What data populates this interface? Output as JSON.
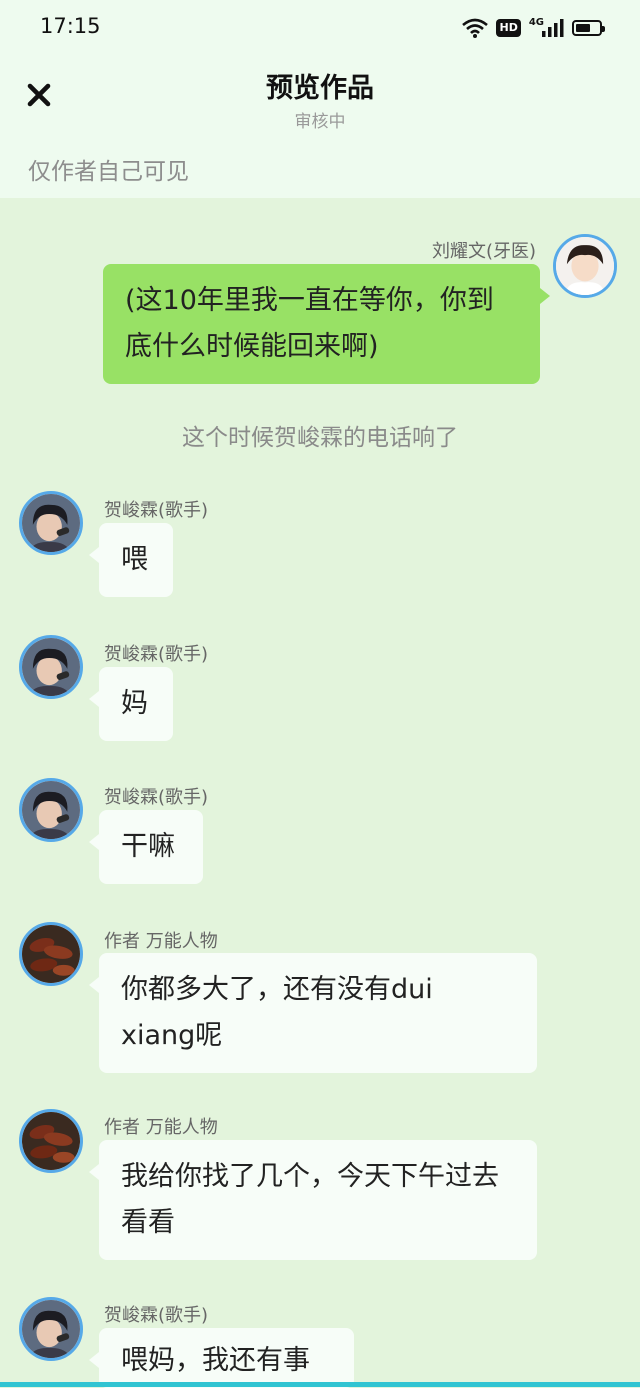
{
  "status_bar": {
    "time": "17:15",
    "hd_label": "HD",
    "network_label": "4G"
  },
  "header": {
    "title": "预览作品",
    "subtitle": "审核中",
    "visibility_note": "仅作者自己可见"
  },
  "messages": [
    {
      "sender": "刘耀文(牙医)",
      "text": "(这10年里我一直在等你，你到底什么时候能回来啊)",
      "side": "right"
    },
    {
      "narration": "这个时候贺峻霖的电话响了"
    },
    {
      "sender": "贺峻霖(歌手)",
      "text": "喂",
      "side": "left"
    },
    {
      "sender": "贺峻霖(歌手)",
      "text": "妈",
      "side": "left"
    },
    {
      "sender": "贺峻霖(歌手)",
      "text": "干嘛",
      "side": "left"
    },
    {
      "sender": "作者 万能人物",
      "text": "你都多大了，还有没有dui xiang呢",
      "side": "left"
    },
    {
      "sender": "作者 万能人物",
      "text": "我给你找了几个，今天下午过去看看",
      "side": "left"
    },
    {
      "sender": "贺峻霖(歌手)",
      "text": "喂妈，我还有事",
      "side": "left"
    }
  ],
  "colors": {
    "chat_background": "#e3f4dc",
    "header_background": "#eefbef",
    "right_bubble": "#98e165",
    "left_bubble": "#f7fdf8",
    "avatar_ring": "#56a9e8",
    "bottom_bar": "#31c4d2"
  }
}
